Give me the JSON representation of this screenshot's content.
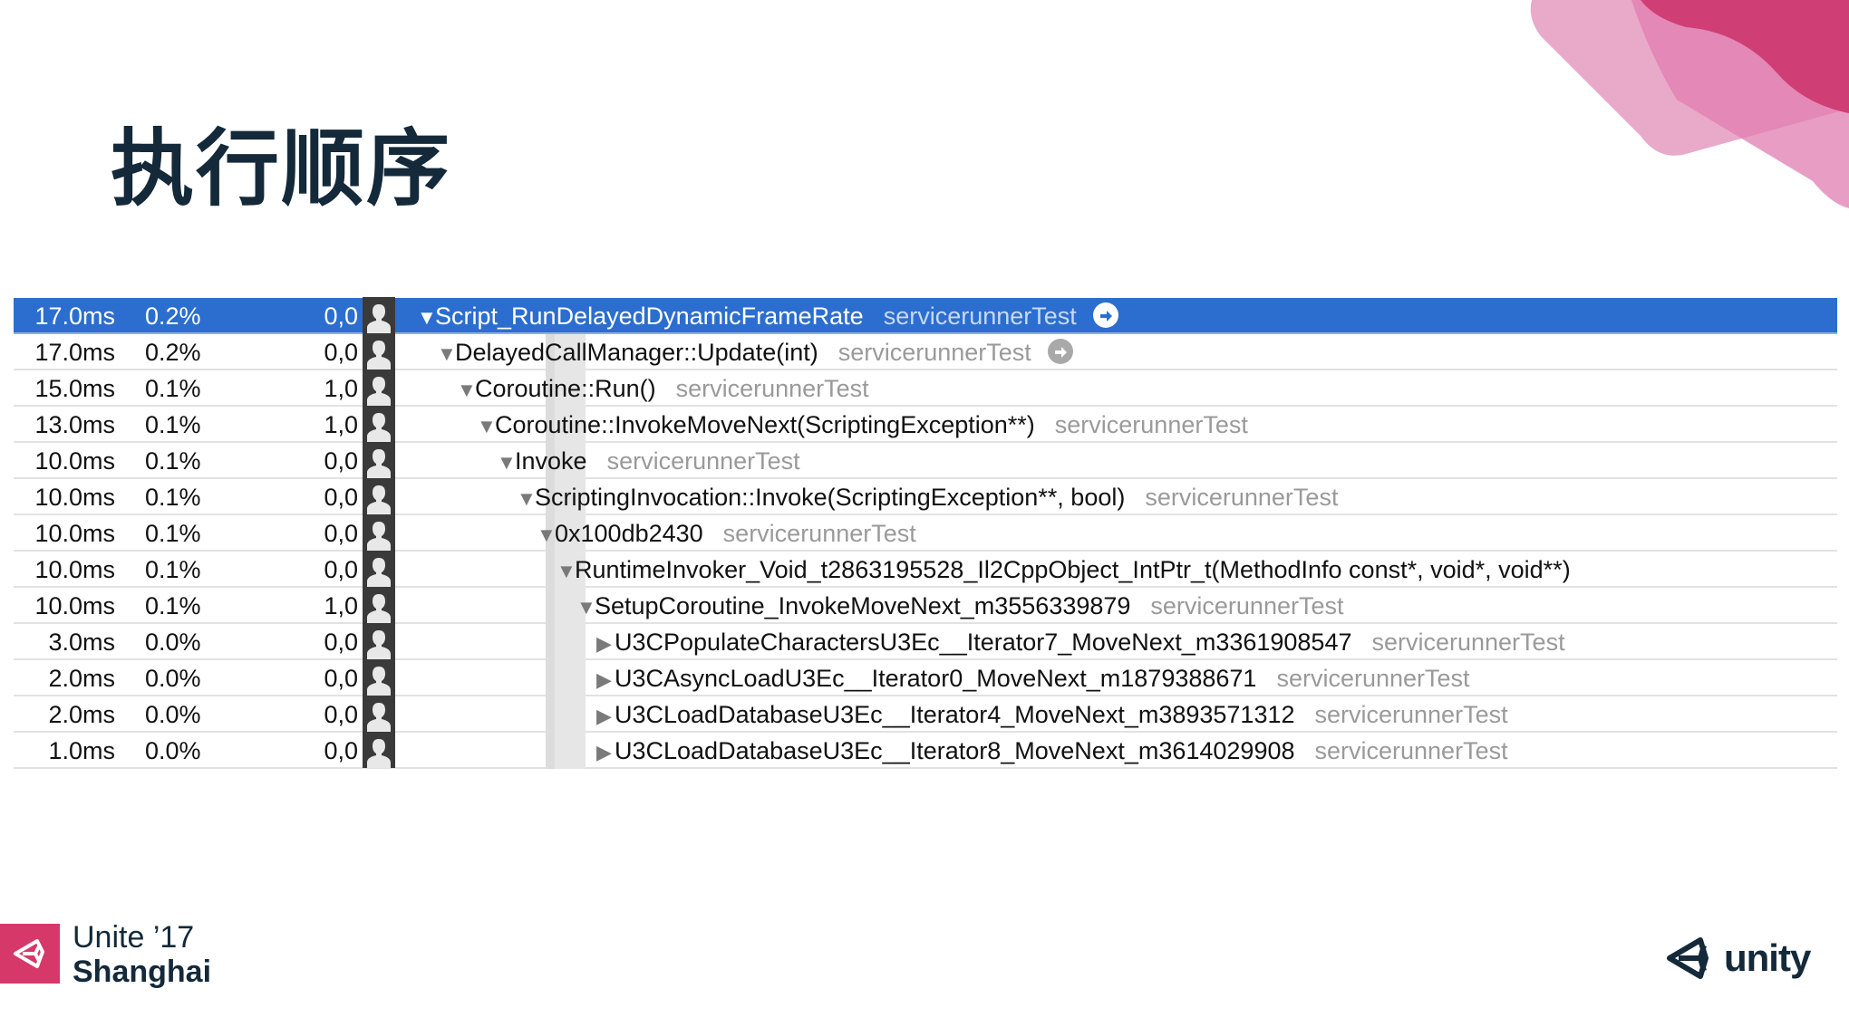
{
  "slide": {
    "title": "执行顺序",
    "accent_color": "#d6386a",
    "title_color": "#14293a"
  },
  "profiler": {
    "selected_color": "#2b6ecf",
    "rows": [
      {
        "time": "17.0ms",
        "percent": "0.2%",
        "self": "0,0",
        "depth": 0,
        "expand": "expanded",
        "symbol": "Script_RunDelayedDynamicFrameRate",
        "library": "servicerunnerTest",
        "go_icon": "light",
        "selected": true
      },
      {
        "time": "17.0ms",
        "percent": "0.2%",
        "self": "0,0",
        "depth": 1,
        "expand": "expanded",
        "symbol": "DelayedCallManager::Update(int)",
        "library": "servicerunnerTest",
        "go_icon": "gray",
        "selected": false
      },
      {
        "time": "15.0ms",
        "percent": "0.1%",
        "self": "1,0",
        "depth": 2,
        "expand": "expanded",
        "symbol": "Coroutine::Run()",
        "library": "servicerunnerTest",
        "go_icon": "",
        "selected": false
      },
      {
        "time": "13.0ms",
        "percent": "0.1%",
        "self": "1,0",
        "depth": 3,
        "expand": "expanded",
        "symbol": "Coroutine::InvokeMoveNext(ScriptingException**)",
        "library": "servicerunnerTest",
        "go_icon": "",
        "selected": false
      },
      {
        "time": "10.0ms",
        "percent": "0.1%",
        "self": "0,0",
        "depth": 4,
        "expand": "expanded",
        "symbol": "Invoke",
        "library": "servicerunnerTest",
        "go_icon": "",
        "selected": false
      },
      {
        "time": "10.0ms",
        "percent": "0.1%",
        "self": "0,0",
        "depth": 5,
        "expand": "expanded",
        "symbol": "ScriptingInvocation::Invoke(ScriptingException**, bool)",
        "library": "servicerunnerTest",
        "go_icon": "",
        "selected": false
      },
      {
        "time": "10.0ms",
        "percent": "0.1%",
        "self": "0,0",
        "depth": 6,
        "expand": "expanded",
        "symbol": "0x100db2430",
        "library": "servicerunnerTest",
        "go_icon": "",
        "selected": false
      },
      {
        "time": "10.0ms",
        "percent": "0.1%",
        "self": "0,0",
        "depth": 7,
        "expand": "expanded",
        "symbol": "RuntimeInvoker_Void_t2863195528_Il2CppObject_IntPtr_t(MethodInfo const*, void*, void**)",
        "library": "",
        "go_icon": "",
        "selected": false
      },
      {
        "time": "10.0ms",
        "percent": "0.1%",
        "self": "1,0",
        "depth": 8,
        "expand": "expanded",
        "symbol": "SetupCoroutine_InvokeMoveNext_m3556339879",
        "library": "servicerunnerTest",
        "go_icon": "",
        "selected": false
      },
      {
        "time": "3.0ms",
        "percent": "0.0%",
        "self": "0,0",
        "depth": 9,
        "expand": "collapsed",
        "symbol": "U3CPopulateCharactersU3Ec__Iterator7_MoveNext_m3361908547",
        "library": "servicerunnerTest",
        "go_icon": "",
        "selected": false
      },
      {
        "time": "2.0ms",
        "percent": "0.0%",
        "self": "0,0",
        "depth": 9,
        "expand": "collapsed",
        "symbol": "U3CAsyncLoadU3Ec__Iterator0_MoveNext_m1879388671",
        "library": "servicerunnerTest",
        "go_icon": "",
        "selected": false
      },
      {
        "time": "2.0ms",
        "percent": "0.0%",
        "self": "0,0",
        "depth": 9,
        "expand": "collapsed",
        "symbol": "U3CLoadDatabaseU3Ec__Iterator4_MoveNext_m3893571312",
        "library": "servicerunnerTest",
        "go_icon": "",
        "selected": false
      },
      {
        "time": "1.0ms",
        "percent": "0.0%",
        "self": "0,0",
        "depth": 9,
        "expand": "collapsed",
        "symbol": "U3CLoadDatabaseU3Ec__Iterator8_MoveNext_m3614029908",
        "library": "servicerunnerTest",
        "go_icon": "",
        "selected": false
      }
    ]
  },
  "footer": {
    "event_line1": "Unite ’17",
    "event_line2": "Shanghai",
    "brand": "unity"
  },
  "icons": {
    "row_user": "user-silhouette-icon",
    "expanded": "▼",
    "collapsed": "▶",
    "go": "arrow-right-circle-icon"
  }
}
